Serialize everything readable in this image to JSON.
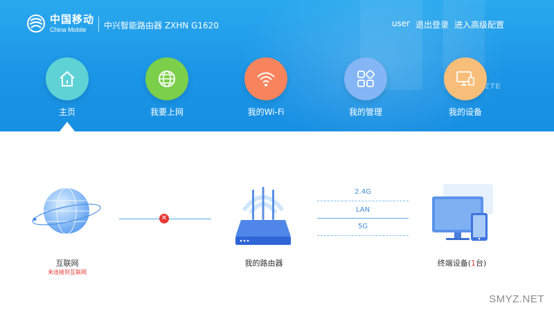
{
  "header": {
    "brand_cn": "中国移动",
    "brand_en": "China Mobile",
    "product_title": "中兴智能路由器 ZXHN G1620",
    "vendor_watermark": "ZTE",
    "user": "user",
    "logout": "退出登录",
    "advanced": "进入高级配置"
  },
  "nav": {
    "items": [
      {
        "label": "主页",
        "icon": "home-icon",
        "color": "#5fd2d6",
        "active": true
      },
      {
        "label": "我要上网",
        "icon": "globe-icon",
        "color": "#7ccf4a",
        "active": false
      },
      {
        "label": "我的Wi-Fi",
        "icon": "wifi-icon",
        "color": "#f7845d",
        "active": false
      },
      {
        "label": "我的管理",
        "icon": "apps-icon",
        "color": "#84b5f4",
        "active": false
      },
      {
        "label": "我的设备",
        "icon": "monitor-icon",
        "color": "#f7be7a",
        "active": false
      }
    ]
  },
  "topology": {
    "internet_label": "互联网",
    "internet_status": "未连接到互联网",
    "router_label": "我的路由器",
    "bands": [
      "2.4G",
      "LAN",
      "5G"
    ],
    "devices_prefix": "终端设备(",
    "devices_count": "1",
    "devices_suffix": "台)"
  },
  "colors": {
    "header_blue": "#1b95e6",
    "error_red": "#e53935",
    "link_blue": "#3d8ed8"
  },
  "watermark": "SMYZ.NET"
}
